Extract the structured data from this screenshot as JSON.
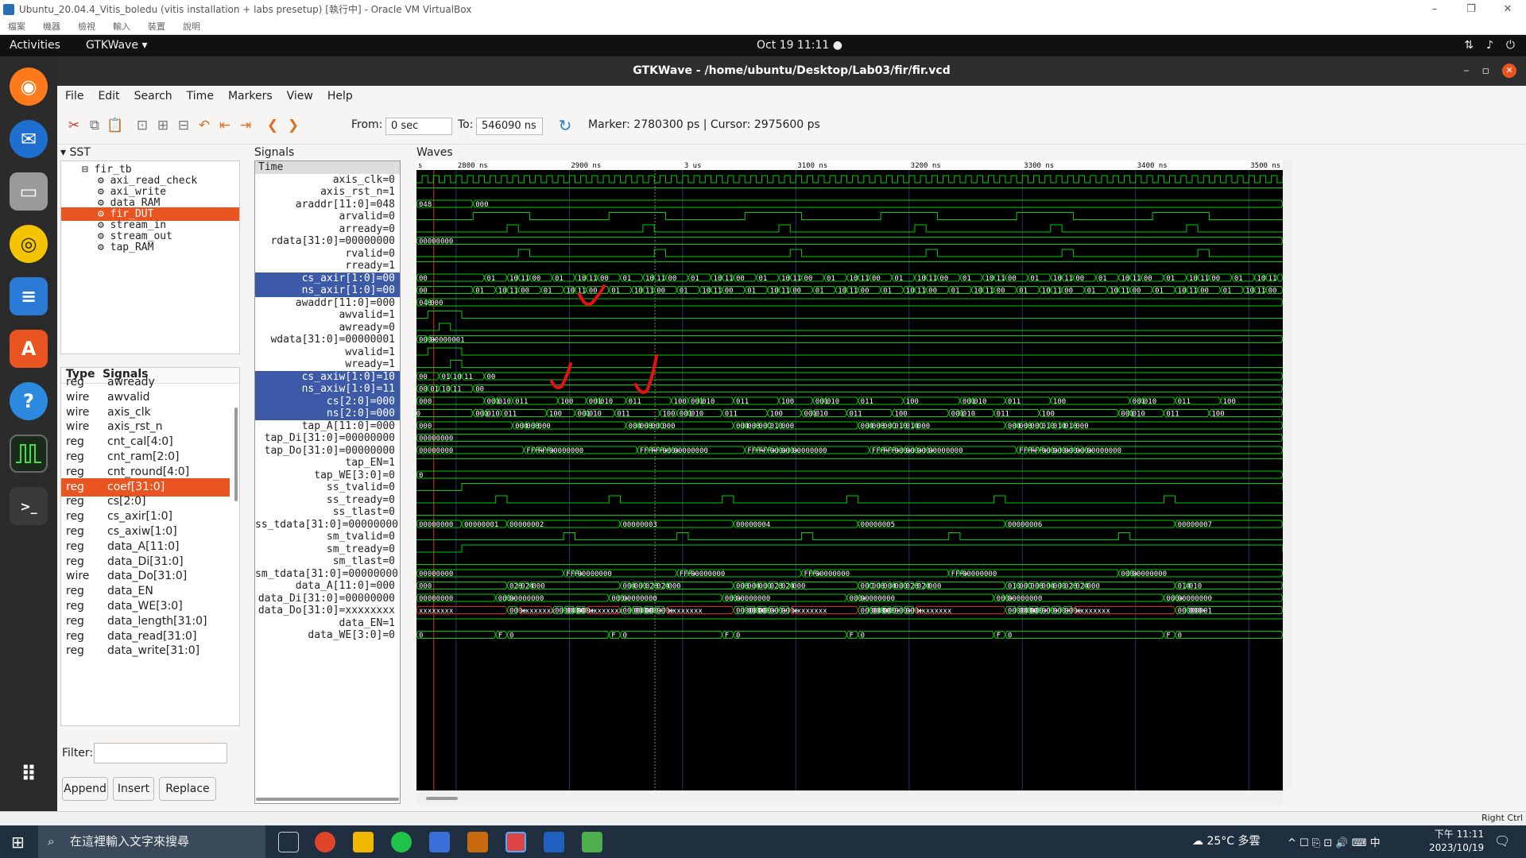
{
  "vbox": {
    "title": "Ubuntu_20.04.4_Vitis_boledu (vitis installation + labs presetup) [執行中] - Oracle VM VirtualBox",
    "menu": [
      "檔案",
      "機器",
      "檢視",
      "輸入",
      "裝置",
      "說明"
    ],
    "status_host_key": "Right Ctrl"
  },
  "gnome": {
    "activities": "Activities",
    "app_name": "GTKWave ▾",
    "clock": "Oct 19  11:11  ●",
    "tray_icons": [
      "network-icon",
      "volume-icon",
      "power-icon"
    ]
  },
  "gtkwave": {
    "title": "GTKWave - /home/ubuntu/Desktop/Lab03/fir/fir.vcd",
    "menu": [
      "File",
      "Edit",
      "Search",
      "Time",
      "Markers",
      "View",
      "Help"
    ],
    "from_label": "From:",
    "from_value": "0 sec",
    "to_label": "To:",
    "to_value": "546090 ns",
    "marker_text": "Marker: 2780300 ps  |  Cursor: 2975600 ps",
    "sst_label": "SST",
    "signals_label": "Signals",
    "waves_label": "Waves",
    "tree": [
      {
        "label": "fir_tb",
        "selected": false
      },
      {
        "label": "axi_read_check",
        "selected": false
      },
      {
        "label": "axi_write",
        "selected": false
      },
      {
        "label": "data_RAM",
        "selected": false
      },
      {
        "label": "fir_DUT",
        "selected": true
      },
      {
        "label": "stream_in",
        "selected": false
      },
      {
        "label": "stream_out",
        "selected": false
      },
      {
        "label": "tap_RAM",
        "selected": false
      }
    ],
    "siglist_headers": {
      "type": "Type",
      "signals": "Signals"
    },
    "siglist": [
      {
        "type": "reg",
        "name": "awready",
        "selected": false
      },
      {
        "type": "wire",
        "name": "awvalid",
        "selected": false
      },
      {
        "type": "wire",
        "name": "axis_clk",
        "selected": false
      },
      {
        "type": "wire",
        "name": "axis_rst_n",
        "selected": false
      },
      {
        "type": "reg",
        "name": "cnt_cal[4:0]",
        "selected": false
      },
      {
        "type": "reg",
        "name": "cnt_ram[2:0]",
        "selected": false
      },
      {
        "type": "reg",
        "name": "cnt_round[4:0]",
        "selected": false
      },
      {
        "type": "reg",
        "name": "coef[31:0]",
        "selected": true
      },
      {
        "type": "reg",
        "name": "cs[2:0]",
        "selected": false
      },
      {
        "type": "reg",
        "name": "cs_axir[1:0]",
        "selected": false
      },
      {
        "type": "reg",
        "name": "cs_axiw[1:0]",
        "selected": false
      },
      {
        "type": "reg",
        "name": "data_A[11:0]",
        "selected": false
      },
      {
        "type": "reg",
        "name": "data_Di[31:0]",
        "selected": false
      },
      {
        "type": "wire",
        "name": "data_Do[31:0]",
        "selected": false
      },
      {
        "type": "reg",
        "name": "data_EN",
        "selected": false
      },
      {
        "type": "reg",
        "name": "data_WE[3:0]",
        "selected": false
      },
      {
        "type": "reg",
        "name": "data_length[31:0]",
        "selected": false
      },
      {
        "type": "reg",
        "name": "data_read[31:0]",
        "selected": false
      },
      {
        "type": "reg",
        "name": "data_write[31:0]",
        "selected": false
      }
    ],
    "filter_label": "Filter:",
    "buttons": {
      "append": "Append",
      "insert": "Insert",
      "replace": "Replace"
    },
    "signals": [
      {
        "label": "Time",
        "kind": "time",
        "selected": false
      },
      {
        "label": "axis_clk=0",
        "selected": false
      },
      {
        "label": "axis_rst_n=1",
        "selected": false
      },
      {
        "label": "araddr[11:0]=048",
        "selected": false
      },
      {
        "label": "arvalid=0",
        "selected": false
      },
      {
        "label": "arready=0",
        "selected": false
      },
      {
        "label": "rdata[31:0]=00000000",
        "selected": false
      },
      {
        "label": "rvalid=0",
        "selected": false
      },
      {
        "label": "rready=1",
        "selected": false
      },
      {
        "label": "cs_axir[1:0]=00",
        "selected": true
      },
      {
        "label": "ns_axir[1:0]=00",
        "selected": true
      },
      {
        "label": "awaddr[11:0]=000",
        "selected": false
      },
      {
        "label": "awvalid=1",
        "selected": false
      },
      {
        "label": "awready=0",
        "selected": false
      },
      {
        "label": "wdata[31:0]=00000001",
        "selected": false
      },
      {
        "label": "wvalid=1",
        "selected": false
      },
      {
        "label": "wready=1",
        "selected": false
      },
      {
        "label": "cs_axiw[1:0]=10",
        "selected": true
      },
      {
        "label": "ns_axiw[1:0]=11",
        "selected": true
      },
      {
        "label": "cs[2:0]=000",
        "selected": true
      },
      {
        "label": "ns[2:0]=000",
        "selected": true
      },
      {
        "label": "tap_A[11:0]=000",
        "selected": false
      },
      {
        "label": "tap_Di[31:0]=00000000",
        "selected": false
      },
      {
        "label": "tap_Do[31:0]=00000000",
        "selected": false
      },
      {
        "label": "tap_EN=1",
        "selected": false
      },
      {
        "label": "tap_WE[3:0]=0",
        "selected": false
      },
      {
        "label": "ss_tvalid=0",
        "selected": false
      },
      {
        "label": "ss_tready=0",
        "selected": false
      },
      {
        "label": "ss_tlast=0",
        "selected": false
      },
      {
        "label": "ss_tdata[31:0]=00000000",
        "selected": false
      },
      {
        "label": "sm_tvalid=0",
        "selected": false
      },
      {
        "label": "sm_tready=0",
        "selected": false
      },
      {
        "label": "sm_tlast=0",
        "selected": false
      },
      {
        "label": "sm_tdata[31:0]=00000000",
        "selected": false
      },
      {
        "label": "data_A[11:0]=000",
        "selected": false
      },
      {
        "label": "data_Di[31:0]=00000000",
        "selected": false
      },
      {
        "label": "data_Do[31:0]=xxxxxxxx",
        "selected": false
      },
      {
        "label": "data_EN=1",
        "selected": false
      },
      {
        "label": "data_WE[3:0]=0",
        "selected": false
      }
    ],
    "time_axis": {
      "ticks": [
        "s",
        "2800 ns",
        "2900 ns",
        "3 us",
        "3100 ns",
        "3200 ns",
        "3300 ns",
        "3400 ns",
        "3500 ns"
      ],
      "t_start_ns": 2765,
      "t_end_ns": 3530,
      "marker_ns": 2780.3,
      "cursor_ns": 2975.6
    },
    "wave_values": {
      "araddr": [
        "048",
        "000"
      ],
      "rdata": [
        "00000000"
      ],
      "cs_axir": [
        "00",
        "01",
        "10",
        "11",
        "00"
      ],
      "ns_axir": [
        "00",
        "01",
        "10",
        "11",
        "00"
      ],
      "awaddr": [
        "048",
        "000"
      ],
      "wdata": [
        "000+",
        "00000001"
      ],
      "cs_axiw": [
        "00",
        "01",
        "10",
        "11",
        "00"
      ],
      "ns_axiw": [
        "00",
        "01",
        "10",
        "11",
        "00"
      ],
      "cs": [
        "000",
        "001",
        "010",
        "011",
        "100",
        "001",
        "010"
      ],
      "ns": [
        "000",
        "001",
        "010",
        "011",
        "100",
        "001",
        "010"
      ],
      "tap_A": [
        "000",
        "004",
        "008",
        "000",
        "00C",
        "010",
        "014",
        "018"
      ],
      "tap_Di": [
        "00000000"
      ],
      "tap_Do": [
        "00000000",
        "FFF+",
        "000+"
      ],
      "tap_WE": [
        "0"
      ],
      "ss_tdata": [
        "00000000",
        "00000001",
        "00000002",
        "00000003",
        "00000004",
        "00000005",
        "00000006",
        "00000007"
      ],
      "sm_tdata": [
        "00000000",
        "FFF+"
      ],
      "data_A": [
        "000",
        "028",
        "024",
        "004",
        "008",
        "00C",
        "010",
        "014"
      ],
      "data_Di": [
        "00000000",
        "000+"
      ],
      "data_Do": [
        "xxxxxxxx",
        "000+",
        "00000001"
      ],
      "data_WE": [
        "0",
        "F"
      ]
    },
    "wave_color": "#00d000",
    "marker_color": "#e03020",
    "annotation_color": "#e81010"
  },
  "taskbar": {
    "search_placeholder": "在這裡輸入文字來搜尋",
    "weather": "25°C  多雲",
    "tray_text": "^  ☐  ⎘  ⊡  🔊  ⌨  中",
    "time": "下午 11:11",
    "date": "2023/10/19"
  }
}
